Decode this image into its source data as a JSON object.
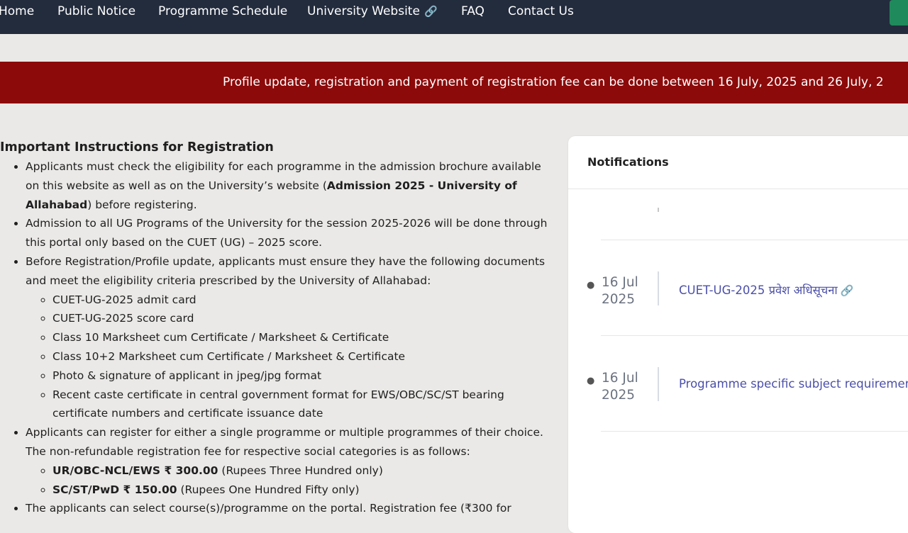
{
  "nav": {
    "items": [
      {
        "label": "Home"
      },
      {
        "label": "Public Notice"
      },
      {
        "label": "Programme Schedule"
      },
      {
        "label": "University Website",
        "icon": "external-link-icon"
      },
      {
        "label": "FAQ"
      },
      {
        "label": "Contact Us"
      }
    ],
    "link_icon": "🔗",
    "accent_button_color": "#1f8a5b"
  },
  "banner": {
    "text": "Profile update, registration and payment of registration fee can be done between 16 July, 2025 and 26 July, 2",
    "color": "#8c0a0a"
  },
  "instructions": {
    "title": "Important Instructions for Registration",
    "items": [
      {
        "t1": "Applicants must check the eligibility for each programme in the admission brochure available on this website as well as on the University’s website (",
        "bold": "Admission 2025 - University of Allahabad",
        "t2": ") before registering."
      },
      {
        "text": "Admission to all UG Programs of the University for the session 2025-2026 will be done through this portal only based on the CUET (UG) – 2025 score."
      },
      {
        "text": "Before Registration/Profile update, applicants must ensure they have the following documents and meet the eligibility criteria prescribed by the University of Allahabad:",
        "sub": [
          "CUET-UG-2025 admit card",
          "CUET-UG-2025 score card",
          "Class 10 Marksheet cum Certificate / Marksheet & Certificate",
          "Class 10+2 Marksheet cum Certificate / Marksheet & Certificate",
          "Photo & signature of applicant in jpeg/jpg format",
          "Recent caste certificate in central government format for EWS/OBC/SC/ST bearing certificate numbers and certificate issuance date"
        ]
      },
      {
        "text": "Applicants can register for either a single programme or multiple programmes of their choice. The non-refundable registration fee for respective social categories is as follows:",
        "fees": [
          {
            "bold": "UR/OBC-NCL/EWS ₹ 300.00",
            "rest": " (Rupees Three Hundred only)"
          },
          {
            "bold": "SC/ST/PwD ₹ 150.00",
            "rest": " (Rupees One Hundred Fifty only)"
          }
        ]
      },
      {
        "text": "The applicants can select course(s)/programme on the portal. Registration fee (₹300 for"
      }
    ]
  },
  "notifications": {
    "title": "Notifications",
    "items": [
      {
        "date": "16 Jul 2025",
        "text": "CUET-UG-2025 प्रवेश अधिसूचना",
        "icon": "🔗"
      },
      {
        "date": "16 Jul 2025",
        "text": "Programme specific subject requirement"
      }
    ]
  }
}
